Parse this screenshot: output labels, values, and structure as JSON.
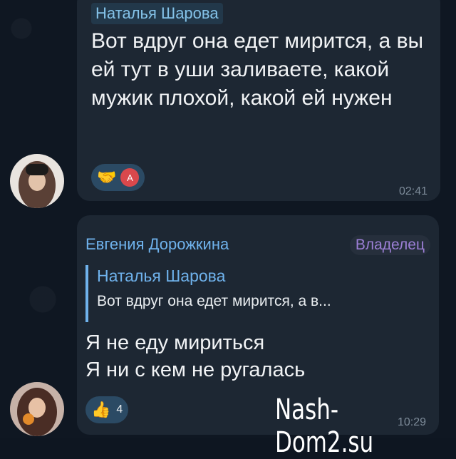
{
  "messages": [
    {
      "sender": "Наталья Шарова",
      "text": "Вот вдруг она едет мирится, а вы ей тут в уши заливаете, какой мужик плохой, какой ей нужен",
      "reaction_icon": "handshake-icon",
      "reactor_initial": "A",
      "time": "02:41"
    },
    {
      "sender": "Евгения Дорожкина",
      "badge": "Владелец",
      "reply": {
        "name": "Наталья Шарова",
        "text": "Вот вдруг она едет мирится, а в..."
      },
      "text_lines": [
        "Я не еду мириться",
        "Я ни с кем не ругалась"
      ],
      "reaction_icon": "thumbs-up-icon",
      "reaction_count": "4",
      "time": "10:29"
    }
  ],
  "watermark": "Nash-Dom2.su",
  "colors": {
    "background": "#0e1621",
    "bubble": "#1d2733",
    "name_blue": "#6fb2ec",
    "badge_purple": "#9c7fd6",
    "reaction_pill": "#2b4a64",
    "avatar_red": "#d9484c"
  }
}
